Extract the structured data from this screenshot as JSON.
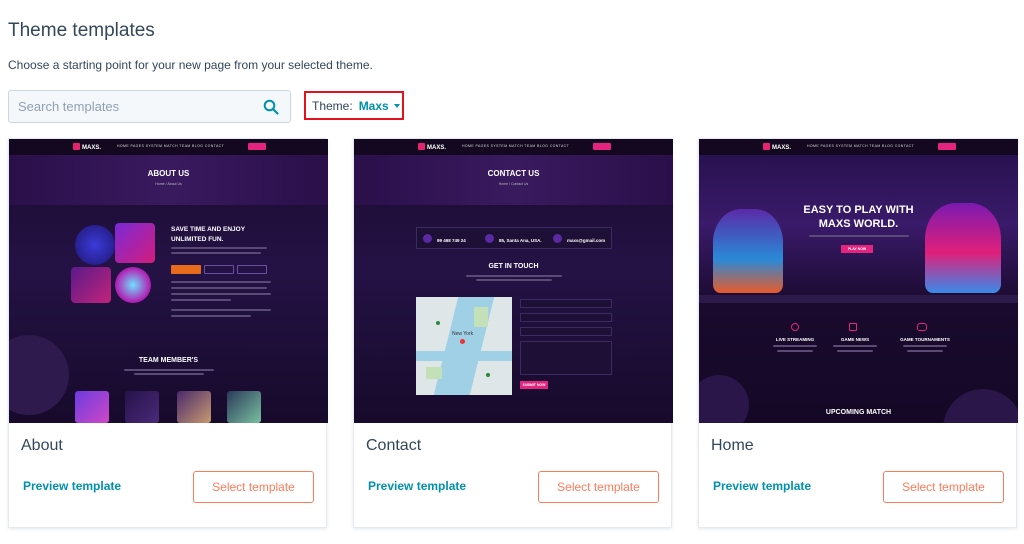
{
  "header": {
    "title": "Theme templates",
    "subtitle": "Choose a starting point for your new page from your selected theme."
  },
  "search": {
    "placeholder": "Search templates",
    "value": ""
  },
  "theme_filter": {
    "label": "Theme:",
    "value": "Maxs"
  },
  "colors": {
    "accent": "#0091ae",
    "cta": "#ff7a59",
    "highlight": "#e3121c",
    "text": "#33475b"
  },
  "thumbnail_common": {
    "logo": "MAXS.",
    "nav": "HOME    PAGES    SYSTEM    MATCH    TEAM    BLOG    CONTACT"
  },
  "cards": [
    {
      "name": "About",
      "preview_label": "Preview template",
      "select_label": "Select template",
      "thumb": {
        "title": "ABOUT US",
        "crumb": "Home / About Us",
        "heading": "SAVE TIME AND ENJOY UNLIMITED FUN.",
        "section": "TEAM MEMBER'S"
      }
    },
    {
      "name": "Contact",
      "preview_label": "Preview template",
      "select_label": "Select template",
      "thumb": {
        "title": "CONTACT US",
        "crumb": "Home / Contact Us",
        "phone": "99 468 749 24",
        "address": "85, Santa Ana, USA.",
        "email": "maxs@gmail.com",
        "heading": "GET IN TOUCH",
        "map_label": "New York",
        "submit": "SUBMIT NOW"
      }
    },
    {
      "name": "Home",
      "preview_label": "Preview template",
      "select_label": "Select template",
      "thumb": {
        "hero_line1": "EASY TO PLAY WITH",
        "hero_line2": "MAXS WORLD.",
        "cta": "PLAY NOW",
        "feature1": "LIVE STREAMING",
        "feature2": "GAME NEWS",
        "feature3": "GAME TOURNAMENTS",
        "section": "UPCOMING MATCH"
      }
    }
  ]
}
